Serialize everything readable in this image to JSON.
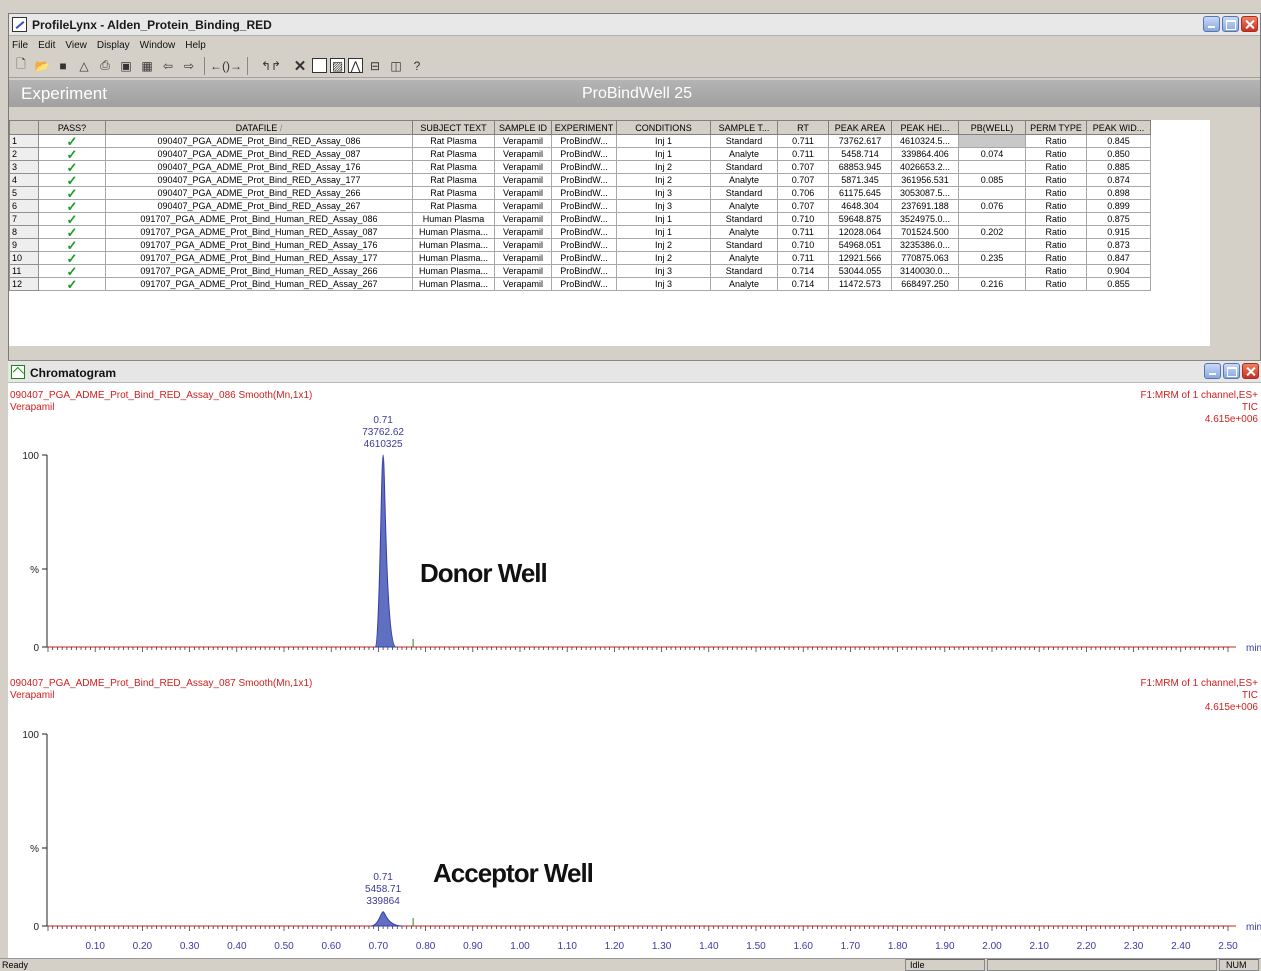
{
  "window": {
    "title": "ProfileLynx - Alden_Protein_Binding_RED"
  },
  "menu": [
    "File",
    "Edit",
    "View",
    "Display",
    "Window",
    "Help"
  ],
  "toolbar_icons": [
    "new-icon",
    "open-icon",
    "save-icon",
    "chart-icon",
    "print-icon",
    "copy-icon",
    "grid-icon",
    "arrow-left-icon",
    "arrow-right-icon",
    "bracket-icon",
    "peak-icon",
    "cross-icon",
    "window-icon",
    "chromatogram-icon",
    "table-icon",
    "split-icon",
    "help-icon"
  ],
  "experiment": {
    "label": "Experiment",
    "name": "ProBindWell 25"
  },
  "table": {
    "columns": [
      "PASS?",
      "DATAFILE",
      "SUBJECT TEXT",
      "SAMPLE ID",
      "EXPERIMENT",
      "CONDITIONS",
      "SAMPLE T...",
      "RT",
      "PEAK AREA",
      "PEAK HEI...",
      "PB(WELL)",
      "PERM TYPE",
      "PEAK WID..."
    ],
    "sort_marker": "/",
    "rows": [
      [
        "1",
        "✓",
        "090407_PGA_ADME_Prot_Bind_RED_Assay_086",
        "Rat Plasma",
        "Verapamil",
        "ProBindW...",
        "Inj 1",
        "Standard",
        "0.711",
        "73762.617",
        "4610324.5...",
        "",
        "Ratio",
        "0.845"
      ],
      [
        "2",
        "✓",
        "090407_PGA_ADME_Prot_Bind_RED_Assay_087",
        "Rat Plasma",
        "Verapamil",
        "ProBindW...",
        "Inj 1",
        "Analyte",
        "0.711",
        "5458.714",
        "339864.406",
        "0.074",
        "Ratio",
        "0.850"
      ],
      [
        "3",
        "✓",
        "090407_PGA_ADME_Prot_Bind_RED_Assay_176",
        "Rat Plasma",
        "Verapamil",
        "ProBindW...",
        "Inj 2",
        "Standard",
        "0.707",
        "68853.945",
        "4026653.2...",
        "",
        "Ratio",
        "0.885"
      ],
      [
        "4",
        "✓",
        "090407_PGA_ADME_Prot_Bind_RED_Assay_177",
        "Rat Plasma",
        "Verapamil",
        "ProBindW...",
        "Inj 2",
        "Analyte",
        "0.707",
        "5871.345",
        "361956.531",
        "0.085",
        "Ratio",
        "0.874"
      ],
      [
        "5",
        "✓",
        "090407_PGA_ADME_Prot_Bind_RED_Assay_266",
        "Rat Plasma",
        "Verapamil",
        "ProBindW...",
        "Inj 3",
        "Standard",
        "0.706",
        "61175.645",
        "3053087.5...",
        "",
        "Ratio",
        "0.898"
      ],
      [
        "6",
        "✓",
        "090407_PGA_ADME_Prot_Bind_RED_Assay_267",
        "Rat Plasma",
        "Verapamil",
        "ProBindW...",
        "Inj 3",
        "Analyte",
        "0.707",
        "4648.304",
        "237691.188",
        "0.076",
        "Ratio",
        "0.899"
      ],
      [
        "7",
        "✓",
        "091707_PGA_ADME_Prot_Bind_Human_RED_Assay_086",
        "Human Plasma",
        "Verapamil",
        "ProBindW...",
        "Inj 1",
        "Standard",
        "0.710",
        "59648.875",
        "3524975.0...",
        "",
        "Ratio",
        "0.875"
      ],
      [
        "8",
        "✓",
        "091707_PGA_ADME_Prot_Bind_Human_RED_Assay_087",
        "Human Plasma...",
        "Verapamil",
        "ProBindW...",
        "Inj 1",
        "Analyte",
        "0.711",
        "12028.064",
        "701524.500",
        "0.202",
        "Ratio",
        "0.915"
      ],
      [
        "9",
        "✓",
        "091707_PGA_ADME_Prot_Bind_Human_RED_Assay_176",
        "Human Plasma...",
        "Verapamil",
        "ProBindW...",
        "Inj 2",
        "Standard",
        "0.710",
        "54968.051",
        "3235386.0...",
        "",
        "Ratio",
        "0.873"
      ],
      [
        "10",
        "✓",
        "091707_PGA_ADME_Prot_Bind_Human_RED_Assay_177",
        "Human Plasma...",
        "Verapamil",
        "ProBindW...",
        "Inj 2",
        "Analyte",
        "0.711",
        "12921.566",
        "770875.063",
        "0.235",
        "Ratio",
        "0.847"
      ],
      [
        "11",
        "✓",
        "091707_PGA_ADME_Prot_Bind_Human_RED_Assay_266",
        "Human Plasma...",
        "Verapamil",
        "ProBindW...",
        "Inj 3",
        "Standard",
        "0.714",
        "53044.055",
        "3140030.0...",
        "",
        "Ratio",
        "0.904"
      ],
      [
        "12",
        "✓",
        "091707_PGA_ADME_Prot_Bind_Human_RED_Assay_267",
        "Human Plasma...",
        "Verapamil",
        "ProBindW...",
        "Inj 3",
        "Analyte",
        "0.714",
        "11472.573",
        "668497.250",
        "0.216",
        "Ratio",
        "0.855"
      ]
    ]
  },
  "chromatogram": {
    "title": "Chromatogram",
    "colors": {
      "header_text": "#d02020",
      "trace": "#3a3aaa",
      "peak_fill": "#6070c0",
      "axis": "#222222",
      "baseline": "#d02020"
    },
    "x_ticks": [
      "0.10",
      "0.20",
      "0.30",
      "0.40",
      "0.50",
      "0.60",
      "0.70",
      "0.80",
      "0.90",
      "1.00",
      "1.10",
      "1.20",
      "1.30",
      "1.40",
      "1.50",
      "1.60",
      "1.70",
      "1.80",
      "1.90",
      "2.00",
      "2.10",
      "2.20",
      "2.30",
      "2.40",
      "2.50"
    ],
    "x_unit": "min",
    "y_ticks": [
      "100",
      "%",
      "0"
    ],
    "panels": [
      {
        "file_label": "090407_PGA_ADME_Prot_Bind_RED_Assay_086 Smooth(Mn,1x1)",
        "compound": "Verapamil",
        "channel": "F1:MRM of 1 channel,ES+",
        "tic": "TIC",
        "scale": "4.615e+006",
        "peak_rt": "0.71",
        "peak_area": "73762.62",
        "peak_height": "4610325",
        "peak_rel_height": 100,
        "annotation": "Donor Well"
      },
      {
        "file_label": "090407_PGA_ADME_Prot_Bind_RED_Assay_087 Smooth(Mn,1x1)",
        "compound": "Verapamil",
        "channel": "F1:MRM of 1 channel,ES+",
        "tic": "TIC",
        "scale": "4.615e+006",
        "peak_rt": "0.71",
        "peak_area": "5458.71",
        "peak_height": "339864",
        "peak_rel_height": 7.4,
        "annotation": "Acceptor Well"
      }
    ]
  },
  "statusbar": {
    "left": "Ready",
    "middle": "Idle",
    "right": "NUM"
  }
}
